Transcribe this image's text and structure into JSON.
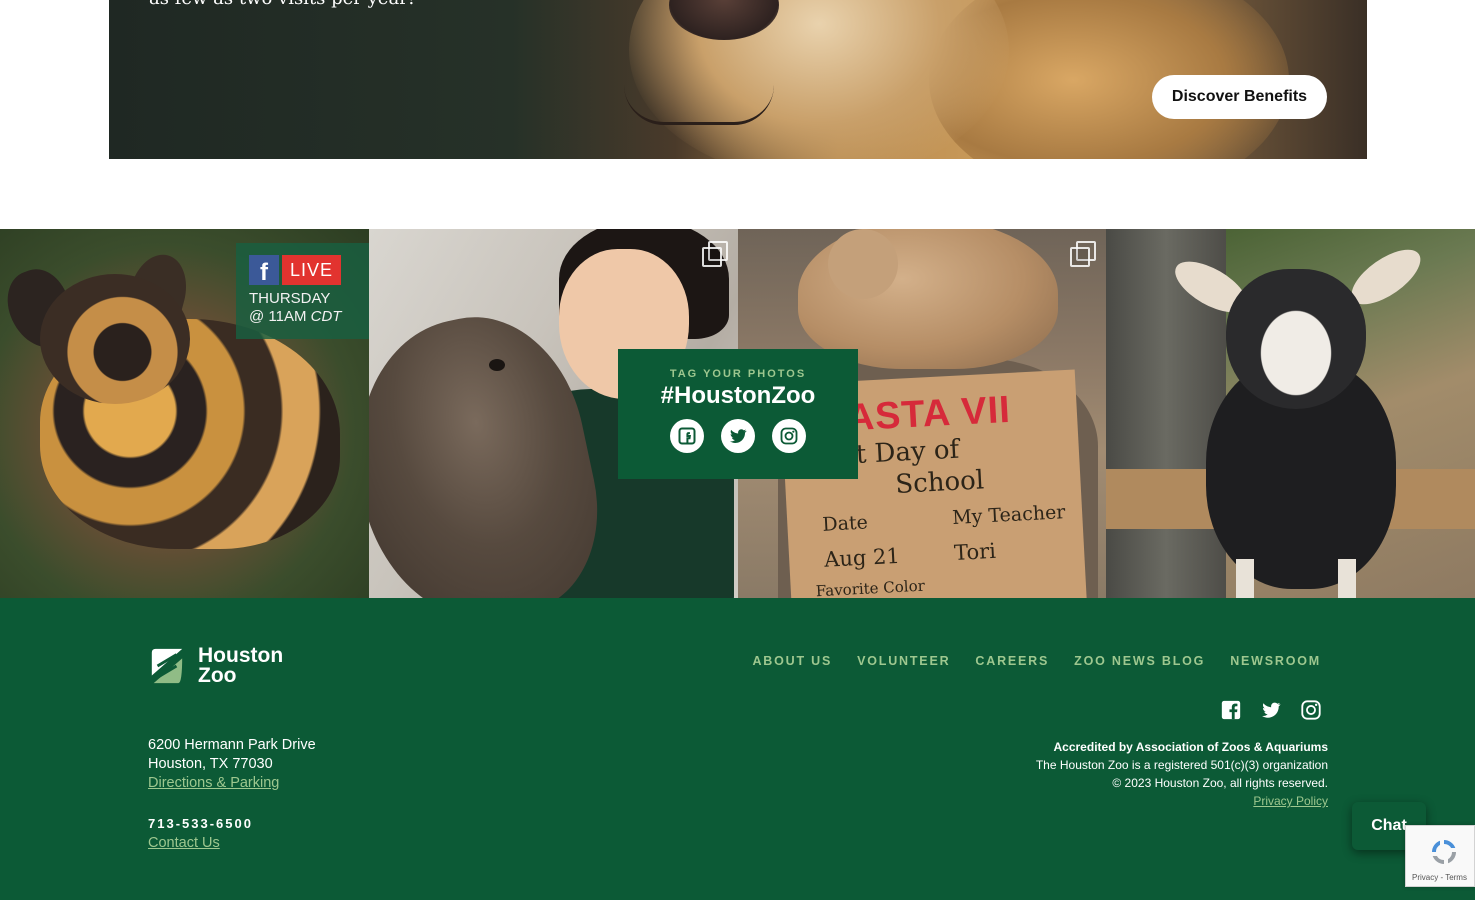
{
  "hero": {
    "caption": "as few as two visits per year!",
    "cta_label": "Discover Benefits"
  },
  "social_feed": {
    "live_badge": {
      "fb_letter": "f",
      "live_label": "LIVE",
      "day": "THURSDAY",
      "time_prefix": "@ 11AM ",
      "time_zone": "CDT"
    },
    "sign": {
      "name": "SHASTA VII",
      "line1": "First Day of",
      "line2": "School",
      "date_label": "Date",
      "date_value": "Aug 21",
      "teacher_label": "My Teacher",
      "teacher_value": "Tori",
      "favorite_label": "Favorite Color"
    },
    "tag_card": {
      "kicker": "TAG YOUR PHOTOS",
      "hashtag": "#HoustonZoo",
      "icons": [
        "facebook-icon",
        "twitter-icon",
        "instagram-icon"
      ]
    }
  },
  "footer": {
    "logo": {
      "line1": "Houston",
      "line2": "Zoo"
    },
    "nav": [
      "ABOUT US",
      "VOLUNTEER",
      "CAREERS",
      "ZOO NEWS BLOG",
      "NEWSROOM"
    ],
    "social_icons": [
      "facebook-icon",
      "twitter-icon",
      "instagram-icon"
    ],
    "address": {
      "line1": "6200 Hermann Park Drive",
      "line2": "Houston, TX 77030",
      "directions_link": "Directions & Parking"
    },
    "phone": "713-533-6500",
    "contact_link": "Contact Us",
    "legal": {
      "accreditation": "Accredited by Association of Zoos & Aquariums",
      "nonprofit": "The Houston Zoo is a registered 501(c)(3) organization",
      "copyright": "© 2023 Houston Zoo, all rights reserved.",
      "privacy_link": "Privacy Policy"
    }
  },
  "chat": {
    "label": "Chat"
  },
  "recaptcha": {
    "links": "Privacy - Terms"
  },
  "colors": {
    "brand_green": "#0c5a36",
    "accent_light_green": "#9ec78f",
    "live_red": "#e2332f",
    "facebook_blue": "#3b5998"
  }
}
